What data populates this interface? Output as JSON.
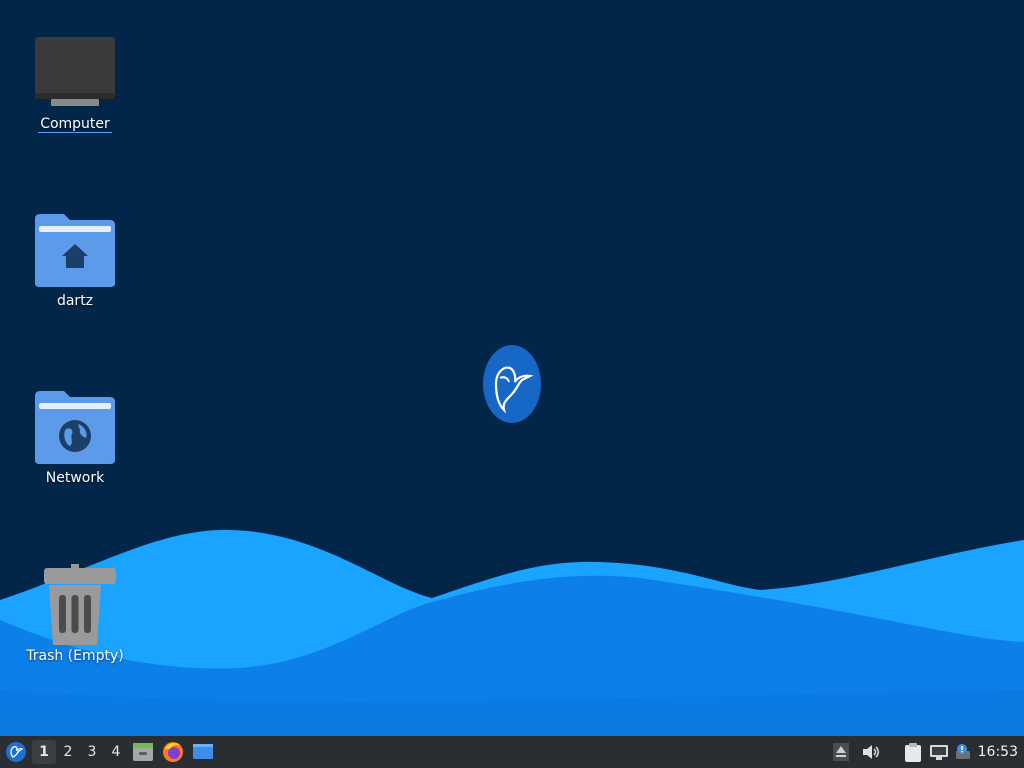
{
  "desktop": {
    "icons": [
      {
        "label": "Computer"
      },
      {
        "label": "dartz"
      },
      {
        "label": "Network"
      },
      {
        "label": "Trash (Empty)"
      }
    ]
  },
  "taskbar": {
    "workspaces": [
      "1",
      "2",
      "3",
      "4"
    ],
    "active_workspace": "1",
    "clock": "16:53"
  },
  "colors": {
    "background": "#01264a",
    "wave_light": "#1aa3ff",
    "wave_dark": "#0a6fe0",
    "taskbar": "#2a2d31",
    "folder": "#5b9bea"
  },
  "icons": [
    "menu-icon",
    "file-manager-icon",
    "firefox-icon",
    "show-desktop-icon",
    "eject-icon",
    "volume-icon",
    "clipboard-icon",
    "network-icon",
    "notification-icon"
  ]
}
